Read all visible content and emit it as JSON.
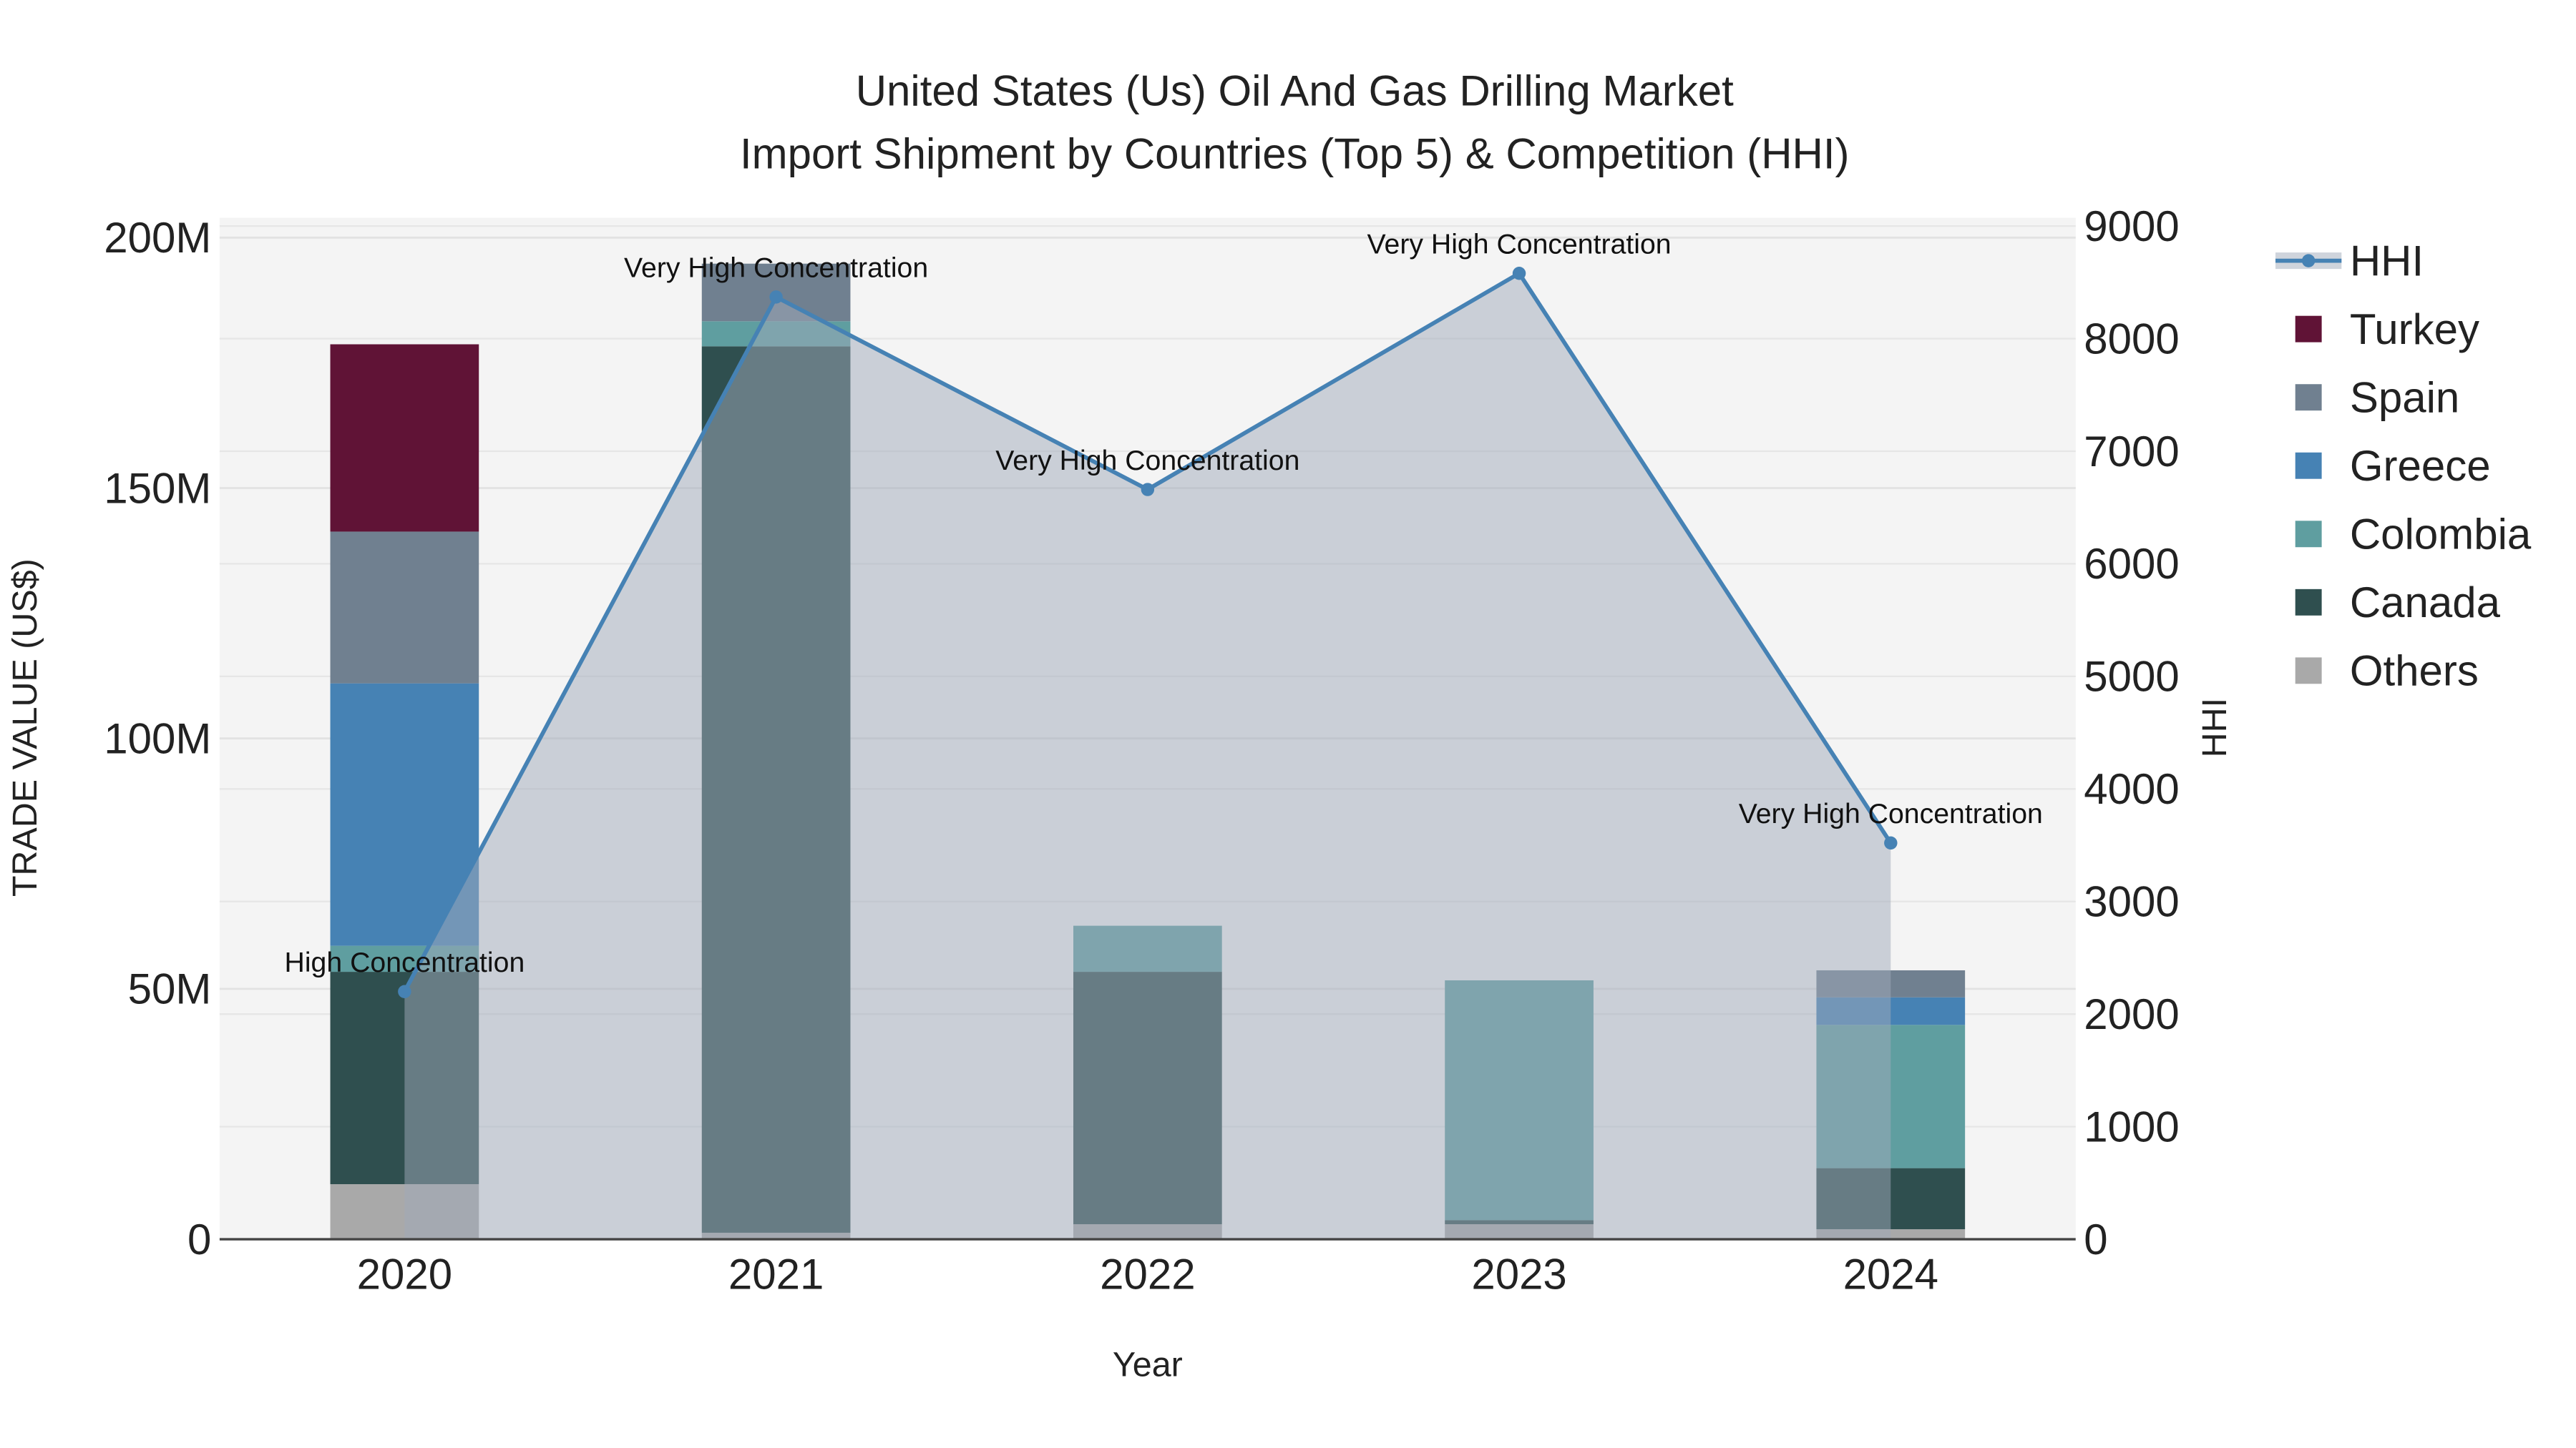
{
  "chart_data": {
    "type": "bar",
    "title_line1": "United States (Us) Oil And Gas Drilling Market",
    "title_line2": "Import Shipment by Countries (Top 5) & Competition (HHI)",
    "xlabel": "Year",
    "ylabel": "TRADE VALUE (US$)",
    "y2label": "HHI",
    "categories": [
      "2020",
      "2021",
      "2022",
      "2023",
      "2024"
    ],
    "ylim": [
      0,
      200
    ],
    "y_unit": "M",
    "yticks": [
      0,
      50,
      100,
      150,
      200
    ],
    "ytick_labels": [
      "0",
      "50M",
      "100M",
      "150M",
      "200M"
    ],
    "y2lim": [
      0,
      9000
    ],
    "y2ticks": [
      "0",
      "1000",
      "2000",
      "3000",
      "4000",
      "5000",
      "6000",
      "7000",
      "8000",
      "9000"
    ],
    "series": [
      {
        "name": "Others",
        "color": "#a9a9a9",
        "values": [
          11,
          1.3,
          3,
          3,
          2
        ]
      },
      {
        "name": "Canada",
        "color": "#2f4f4f",
        "values": [
          42.4,
          177,
          50.4,
          0.8,
          12.2
        ]
      },
      {
        "name": "Colombia",
        "color": "#5f9ea0",
        "values": [
          5.2,
          5,
          9.2,
          47.9,
          28.6
        ]
      },
      {
        "name": "Greece",
        "color": "#4682b4",
        "values": [
          52.4,
          0,
          0,
          0,
          5.5
        ]
      },
      {
        "name": "Spain",
        "color": "#708090",
        "values": [
          30.3,
          11.5,
          0,
          0,
          5.4
        ]
      },
      {
        "name": "Turkey",
        "color": "#601336",
        "values": [
          37.4,
          0,
          0,
          0,
          0
        ]
      }
    ],
    "hhi": {
      "name": "HHI",
      "color": "#4682b4",
      "values": [
        2200,
        8370,
        6660,
        8580,
        3520
      ],
      "annotations": [
        "High Concentration",
        "Very High Concentration",
        "Very High Concentration",
        "Very High Concentration",
        "Very High Concentration"
      ]
    },
    "legend": [
      "HHI",
      "Turkey",
      "Spain",
      "Greece",
      "Colombia",
      "Canada",
      "Others"
    ],
    "legend_placement": "right",
    "grid": true
  }
}
